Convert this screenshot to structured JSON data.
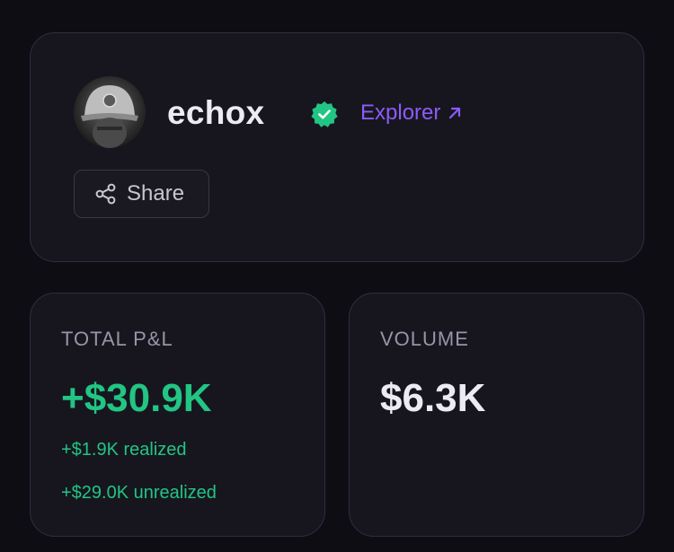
{
  "profile": {
    "username": "echox",
    "verified_color": "#22c583",
    "explorer_label": "Explorer",
    "explorer_icon": "arrow-up-right-icon",
    "share_label": "Share",
    "share_icon": "share-icon",
    "accent_color": "#8b5cf6"
  },
  "stats": {
    "pnl": {
      "label": "TOTAL P&L",
      "value": "+$30.9K",
      "realized": "+$1.9K realized",
      "unrealized": "+$29.0K unrealized"
    },
    "volume": {
      "label": "VOLUME",
      "value": "$6.3K"
    }
  }
}
